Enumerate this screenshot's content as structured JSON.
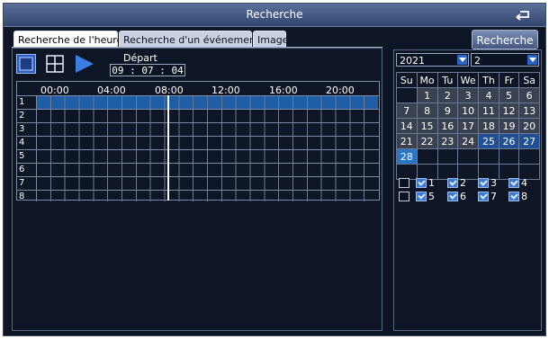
{
  "window": {
    "title": "Recherche"
  },
  "tabs": [
    {
      "label": "Recherche de l'heure",
      "active": true
    },
    {
      "label": "Recherche d'un événement",
      "active": false
    },
    {
      "label": "Image",
      "active": false
    }
  ],
  "search_button": "Recherche",
  "toolbar": {
    "single_view_icon": "square-stop-icon",
    "grid_view_icon": "quad-grid-icon",
    "play_icon": "play-icon"
  },
  "start": {
    "label": "Départ",
    "time": "09 : 07 : 04"
  },
  "timeline": {
    "hours": [
      "00:00",
      "04:00",
      "08:00",
      "12:00",
      "16:00",
      "20:00"
    ],
    "channels": [
      "1",
      "2",
      "3",
      "4",
      "5",
      "6",
      "7",
      "8"
    ],
    "active_channel": "1"
  },
  "calendar": {
    "year": "2021",
    "month": "2",
    "weekdays": [
      "Su",
      "Mo",
      "Tu",
      "We",
      "Th",
      "Fr",
      "Sa"
    ],
    "weeks": [
      [
        "",
        "1",
        "2",
        "3",
        "4",
        "5",
        "6"
      ],
      [
        "7",
        "8",
        "9",
        "10",
        "11",
        "12",
        "13"
      ],
      [
        "14",
        "15",
        "16",
        "17",
        "18",
        "19",
        "20"
      ],
      [
        "21",
        "22",
        "23",
        "24",
        "25",
        "26",
        "27"
      ],
      [
        "28",
        "",
        "",
        "",
        "",
        "",
        ""
      ]
    ],
    "recorded_days": [
      "1",
      "2",
      "3",
      "4",
      "5",
      "6",
      "7",
      "8",
      "9",
      "10",
      "11",
      "12",
      "13",
      "14",
      "15",
      "16",
      "17",
      "18",
      "19",
      "20",
      "21",
      "22",
      "23",
      "24",
      "25",
      "26",
      "27"
    ],
    "marked_days": [
      "25",
      "26",
      "27"
    ],
    "selected_day": "28"
  },
  "channels_select": {
    "all_checked": false,
    "items": [
      {
        "label": "1",
        "checked": true
      },
      {
        "label": "2",
        "checked": true
      },
      {
        "label": "3",
        "checked": true
      },
      {
        "label": "4",
        "checked": true
      },
      {
        "label": "5",
        "checked": true
      },
      {
        "label": "6",
        "checked": true
      },
      {
        "label": "7",
        "checked": true
      },
      {
        "label": "8",
        "checked": true
      }
    ]
  },
  "colors": {
    "background": "#0e1626",
    "active_row": "#1e5ea6",
    "accent": "#2d63c2"
  }
}
